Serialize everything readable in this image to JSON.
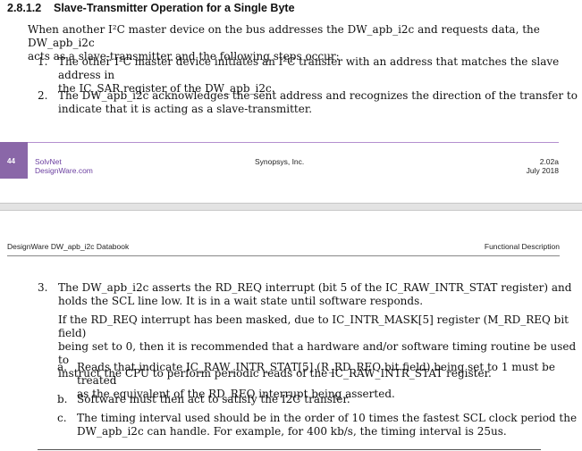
{
  "section": {
    "number": "2.8.1.2",
    "title": "Slave-Transmitter Operation for a Single Byte"
  },
  "intro": {
    "lines": [
      "When another I²C master device on the bus addresses the DW_apb_i2c and requests data, the DW_apb_i2c",
      "acts as a slave-transmitter and the following steps occur:"
    ]
  },
  "steps": [
    {
      "marker": "1.",
      "lines": [
        "The other I²C master device initiates an I²C transfer with an address that matches the slave address in",
        "the IC_SAR register of the DW_apb_i2c."
      ]
    },
    {
      "marker": "2.",
      "lines": [
        "The DW_apb_i2c acknowledges the sent address and recognizes the direction of the transfer to",
        "indicate that it is acting as a slave-transmitter."
      ]
    },
    {
      "marker": "3.",
      "lines": [
        "The DW_apb_i2c asserts the RD_REQ interrupt (bit 5 of the IC_RAW_INTR_STAT register) and",
        "holds the SCL line low. It is in a wait state until software responds."
      ],
      "note_lines": [
        "If the RD_REQ interrupt has been masked, due to IC_INTR_MASK[5] register (M_RD_REQ bit field)",
        "being set to 0, then it is recommended that a hardware and/or software timing routine be used to",
        "instruct the CPU to perform periodic reads of the IC_RAW_INTR_STAT register."
      ],
      "substeps": [
        {
          "marker": "a.",
          "lines": [
            "Reads that indicate IC_RAW_INTR_STAT[5] (R_RD_REQ bit field) being set to 1 must be treated",
            "as the equivalent of the RD_REQ interrupt being asserted."
          ]
        },
        {
          "marker": "b.",
          "lines": [
            "Software must then act to satisfy the I2C transfer."
          ]
        },
        {
          "marker": "c.",
          "lines": [
            "The timing interval used should be in the order of 10 times the fastest SCL clock period the",
            "DW_apb_i2c can handle. For example, for 400 kb/s, the timing interval is 25us."
          ]
        }
      ]
    }
  ],
  "footer": {
    "page_number": "44",
    "solvnet_line1": "SolvNet",
    "solvnet_line2": "DesignWare.com",
    "company": "Synopsys, Inc.",
    "version": "2.02a",
    "date": "July 2018"
  },
  "running_header": {
    "left": "DesignWare DW_apb_i2c Databook",
    "right": "Functional Description"
  },
  "colors": {
    "accent": "#8a67a8",
    "link": "#6b3fa0",
    "rule": "#b48fcf"
  }
}
